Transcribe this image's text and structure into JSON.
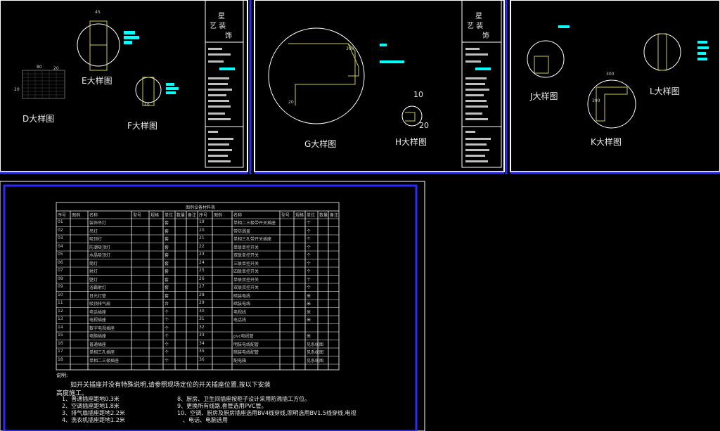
{
  "top_sheets": [
    {
      "labels": {
        "d": "D大样图",
        "e": "E大样图",
        "f": "F大样图"
      },
      "dims": {
        "e_top": "45",
        "d_w": "80",
        "d_h": "20",
        "d_side": "20",
        "f_bottom": "40"
      },
      "title_block": {
        "line1": "星",
        "line2": "艺  装",
        "line3": "饰"
      }
    },
    {
      "labels": {
        "g": "G大样图",
        "h": "H大样图"
      },
      "dims": {
        "g_300": "300",
        "g_20": "20",
        "h_10": "10",
        "h_20": "20"
      },
      "title_block": {
        "line1": "星",
        "line2": "艺  装",
        "line3": "饰"
      }
    },
    {
      "labels": {
        "j": "J大样图",
        "k": "K大样图",
        "l": "L大样图"
      },
      "dims": {
        "k_300": "300",
        "k_side": "300"
      }
    }
  ],
  "table": {
    "title": "图例设备材料表",
    "headers_left": [
      "序号",
      "图例",
      "名称",
      "型号",
      "规格",
      "单位",
      "数量",
      "备注"
    ],
    "headers_right": [
      "序号",
      "图例",
      "名称",
      "型号",
      "规格",
      "单位",
      "数量",
      "备注"
    ],
    "rows_left": [
      [
        "01",
        "装饰吊灯",
        "套"
      ],
      [
        "02",
        "吊灯",
        "套"
      ],
      [
        "03",
        "吸顶灯",
        "套"
      ],
      [
        "04",
        "防潮吸顶灯",
        "套"
      ],
      [
        "05",
        "水晶吸顶灯",
        "套"
      ],
      [
        "06",
        "筒灯",
        "套"
      ],
      [
        "07",
        "射灯",
        "套"
      ],
      [
        "08",
        "壁灯",
        "套"
      ],
      [
        "09",
        "浴霸射灯",
        "套"
      ],
      [
        "10",
        "日光灯管",
        "套"
      ],
      [
        "11",
        "吸顶排气扇",
        "台"
      ],
      [
        "12",
        "电话插座",
        "个"
      ],
      [
        "13",
        "电视插座",
        "个"
      ],
      [
        "14",
        "数字电视插座",
        "个"
      ],
      [
        "15",
        "电脑插座",
        "个"
      ],
      [
        "16",
        "普通插座",
        "个"
      ],
      [
        "17",
        "单相三孔插座",
        "个"
      ],
      [
        "18",
        "单相二三极插座",
        "个"
      ]
    ],
    "rows_right": [
      [
        "19",
        "单相二三极带开关插座",
        "个"
      ],
      [
        "20",
        "带防溅盖",
        "个"
      ],
      [
        "21",
        "单相三孔带开关插座",
        "个"
      ],
      [
        "22",
        "单联单控开关",
        "个"
      ],
      [
        "23",
        "双联单控开关",
        "个"
      ],
      [
        "24",
        "三联单控开关",
        "个"
      ],
      [
        "25",
        "四联单控开关",
        "个"
      ],
      [
        "26",
        "单联双控开关",
        "个"
      ],
      [
        "27",
        "双联双控开关",
        "个"
      ],
      [
        "28",
        "暗装电线",
        "米"
      ],
      [
        "29",
        "暗装电线",
        "米"
      ],
      [
        "30",
        "电视线",
        "米"
      ],
      [
        "31",
        "电话线",
        "米"
      ],
      [
        "32",
        "",
        ""
      ],
      [
        "33",
        "pvc电线管",
        "米"
      ],
      [
        "34",
        "明装电线配管",
        "见系统图"
      ],
      [
        "35",
        "暗装电线配管",
        "见系统图"
      ],
      [
        "36",
        "配电箱",
        "见系统图"
      ]
    ],
    "note_title": "说明:",
    "note_intro": "如开关插座并没有特殊说明,请参照现场定位的开关插座位置,按以下安装",
    "note_intro2": "高度施工。",
    "notes_left": [
      "1、普通插座距地0.3米",
      "2、空调插座距地1.8米",
      "3、排气扇插座距地2.2米",
      "4、洗衣机插座距地1.2米"
    ],
    "notes_right": [
      "8、厨房、卫生间插座按柜子设计采用防溅插工方位。",
      "9、更换所有线路,套管选用PVC管。",
      "10、空调、厨房及厨房插座选用BV4线穿线,照明选用BV1.5线穿线,电视",
      "、电话、电脑选用"
    ]
  }
}
